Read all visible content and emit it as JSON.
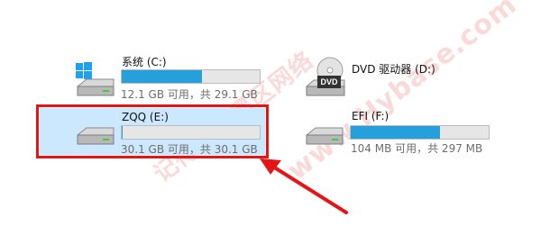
{
  "drives": [
    {
      "id": "c",
      "name": "系统 (C:)",
      "info": "12.1 GB 可用，共 29.1 GB",
      "used_fraction": 0.584,
      "icon": "windows-drive-icon"
    },
    {
      "id": "e",
      "name": "ZQQ (E:)",
      "info": "30.1 GB 可用，共 30.1 GB",
      "used_fraction": 0.003,
      "icon": "hard-drive-icon",
      "selected": true
    },
    {
      "id": "d",
      "name": "DVD 驱动器 (D:)",
      "icon": "dvd-drive-icon"
    },
    {
      "id": "f",
      "name": "EFI (F:)",
      "info": "104 MB 可用，共 297 MB",
      "used_fraction": 0.65,
      "icon": "hard-drive-icon"
    }
  ],
  "watermark": {
    "text": "记得收藏黑区网络",
    "url": "www.Hybase.com"
  },
  "colors": {
    "bar_fill": "#26a0da",
    "selection": "#cce8ff",
    "annotation": "#e51515"
  }
}
